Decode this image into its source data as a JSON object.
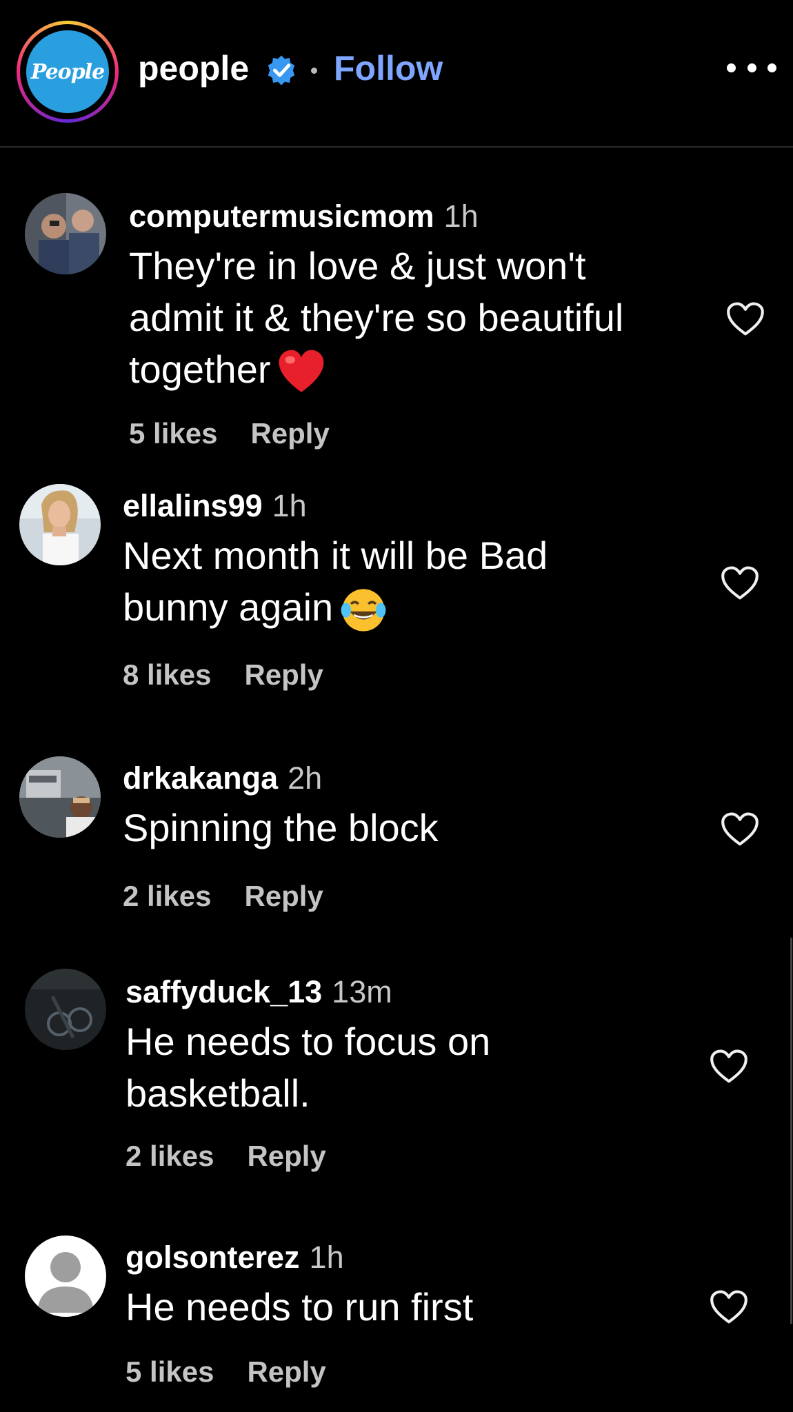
{
  "header": {
    "logo_text": "People",
    "account": "people",
    "follow_label": "Follow"
  },
  "comments": [
    {
      "user": "computermusicmom",
      "time": "1h",
      "text_lines": [
        "They're in love & just won't",
        "admit it & they're so beautiful",
        "together"
      ],
      "emoji": "red-heart",
      "likes": "5 likes",
      "reply": "Reply"
    },
    {
      "user": "ellalins99",
      "time": "1h",
      "text_lines": [
        "Next month it will be Bad",
        "bunny again"
      ],
      "emoji": "laughing-tears",
      "likes": "8 likes",
      "reply": "Reply"
    },
    {
      "user": "drkakanga",
      "time": "2h",
      "text_lines": [
        "Spinning the block"
      ],
      "likes": "2 likes",
      "reply": "Reply"
    },
    {
      "user": "saffyduck_13",
      "time": "13m",
      "text_lines": [
        "He needs to focus on",
        "basketball."
      ],
      "likes": "2 likes",
      "reply": "Reply"
    },
    {
      "user": "golsonterez",
      "time": "1h",
      "text_lines": [
        "He needs to run first"
      ],
      "likes": "5 likes",
      "reply": "Reply"
    }
  ],
  "colors": {
    "background": "#000000",
    "follow": "#7fa6ff",
    "verified": "#3897f0",
    "muted": "#c4c4c4"
  },
  "icons": [
    "verified-badge-icon",
    "more-options-icon",
    "like-heart-icon",
    "red-heart-emoji",
    "laughing-tears-emoji"
  ]
}
